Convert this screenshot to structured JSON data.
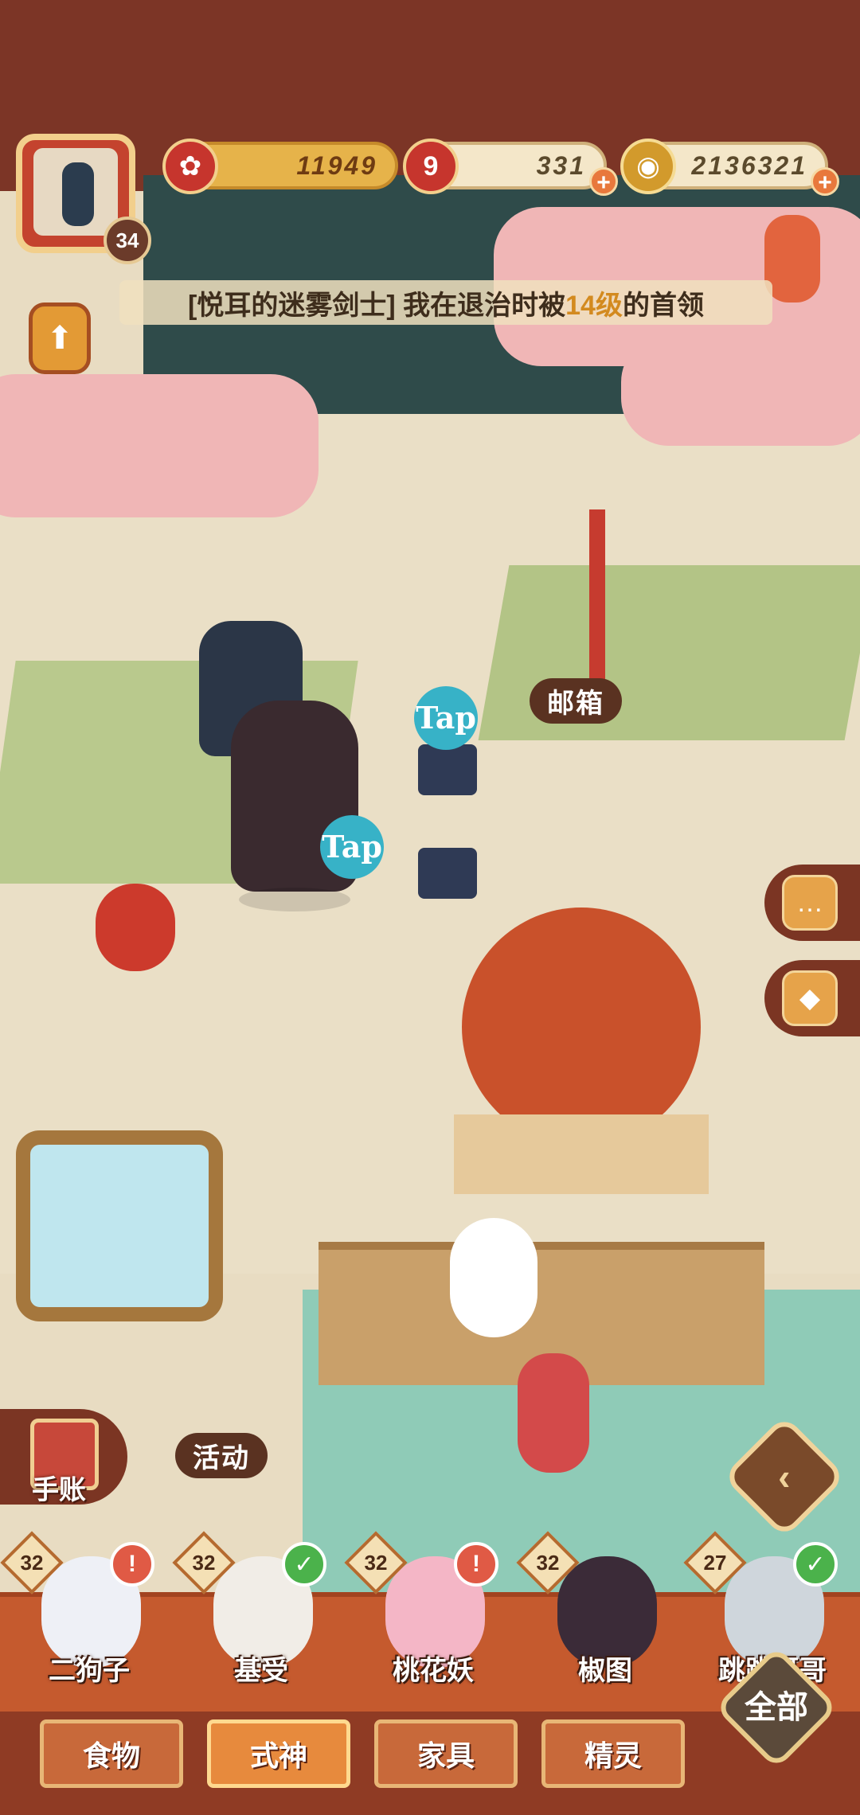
{
  "hud": {
    "player_level": "34",
    "currency_1": "11949",
    "currency_2": "331",
    "currency_3": "2136321",
    "plus": "+",
    "news_prefix": "[悦耳的迷雾剑士] 我在退治时被",
    "news_highlight": "14级",
    "news_suffix": "的首领"
  },
  "map": {
    "mailbox_label": "邮箱",
    "activity_label": "活动",
    "tap_text": "Tap"
  },
  "side": {
    "handbook_label": "手账"
  },
  "characters": [
    {
      "name": "二狗子",
      "level": "32",
      "badge": "request"
    },
    {
      "name": "基受",
      "level": "32",
      "badge": "check"
    },
    {
      "name": "桃花妖",
      "level": "32",
      "badge": "request"
    },
    {
      "name": "椒图",
      "level": "32",
      "badge": "none"
    },
    {
      "name": "跳跳哥哥",
      "level": "27",
      "badge": "check"
    }
  ],
  "tabs": [
    "食物",
    "式神",
    "家具",
    "精灵"
  ],
  "active_tab": "式神",
  "all_button": "全部",
  "colors": {
    "frame_brown": "#7c3526",
    "strip_orange": "#c55a2e",
    "water": "#8fcbb7"
  }
}
